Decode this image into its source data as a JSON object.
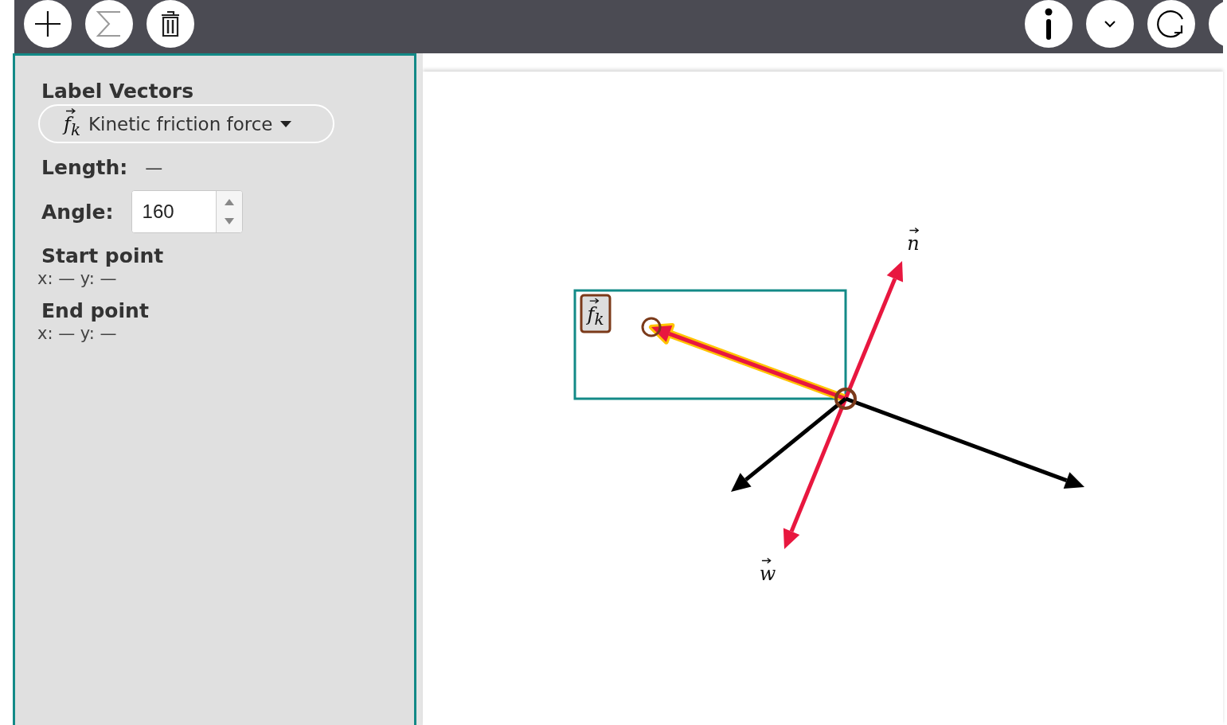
{
  "toolbar": {
    "left_buttons": [
      {
        "kind": "add"
      },
      {
        "kind": "sum"
      },
      {
        "kind": "delete"
      }
    ],
    "right_buttons": [
      {
        "kind": "info"
      },
      {
        "kind": "collapse"
      },
      {
        "kind": "reset"
      },
      {
        "kind": "blank"
      }
    ]
  },
  "sidebar": {
    "title": "Label Vectors",
    "dropdown": {
      "symbol": "f$_{k}$",
      "text": "Kinetic friction force"
    },
    "length": {
      "label": "Length:",
      "value": "—"
    },
    "angle": {
      "label": "Angle:",
      "value": "160"
    },
    "points": [
      {
        "title": "Start point",
        "coords": "x: — y: —"
      },
      {
        "title": "End point",
        "coords": "x: — y: —"
      }
    ]
  },
  "canvas": {
    "vectors": [
      {
        "label": "f$_{k}$",
        "color": "#e8173f",
        "selected": true
      },
      {
        "label": "n",
        "color": "#e8173f",
        "selected": false
      },
      {
        "label": "w",
        "color": "#e8173f",
        "selected": false
      },
      {
        "color": "#000000",
        "selected": false
      },
      {
        "color": "#000000",
        "selected": false
      }
    ]
  }
}
